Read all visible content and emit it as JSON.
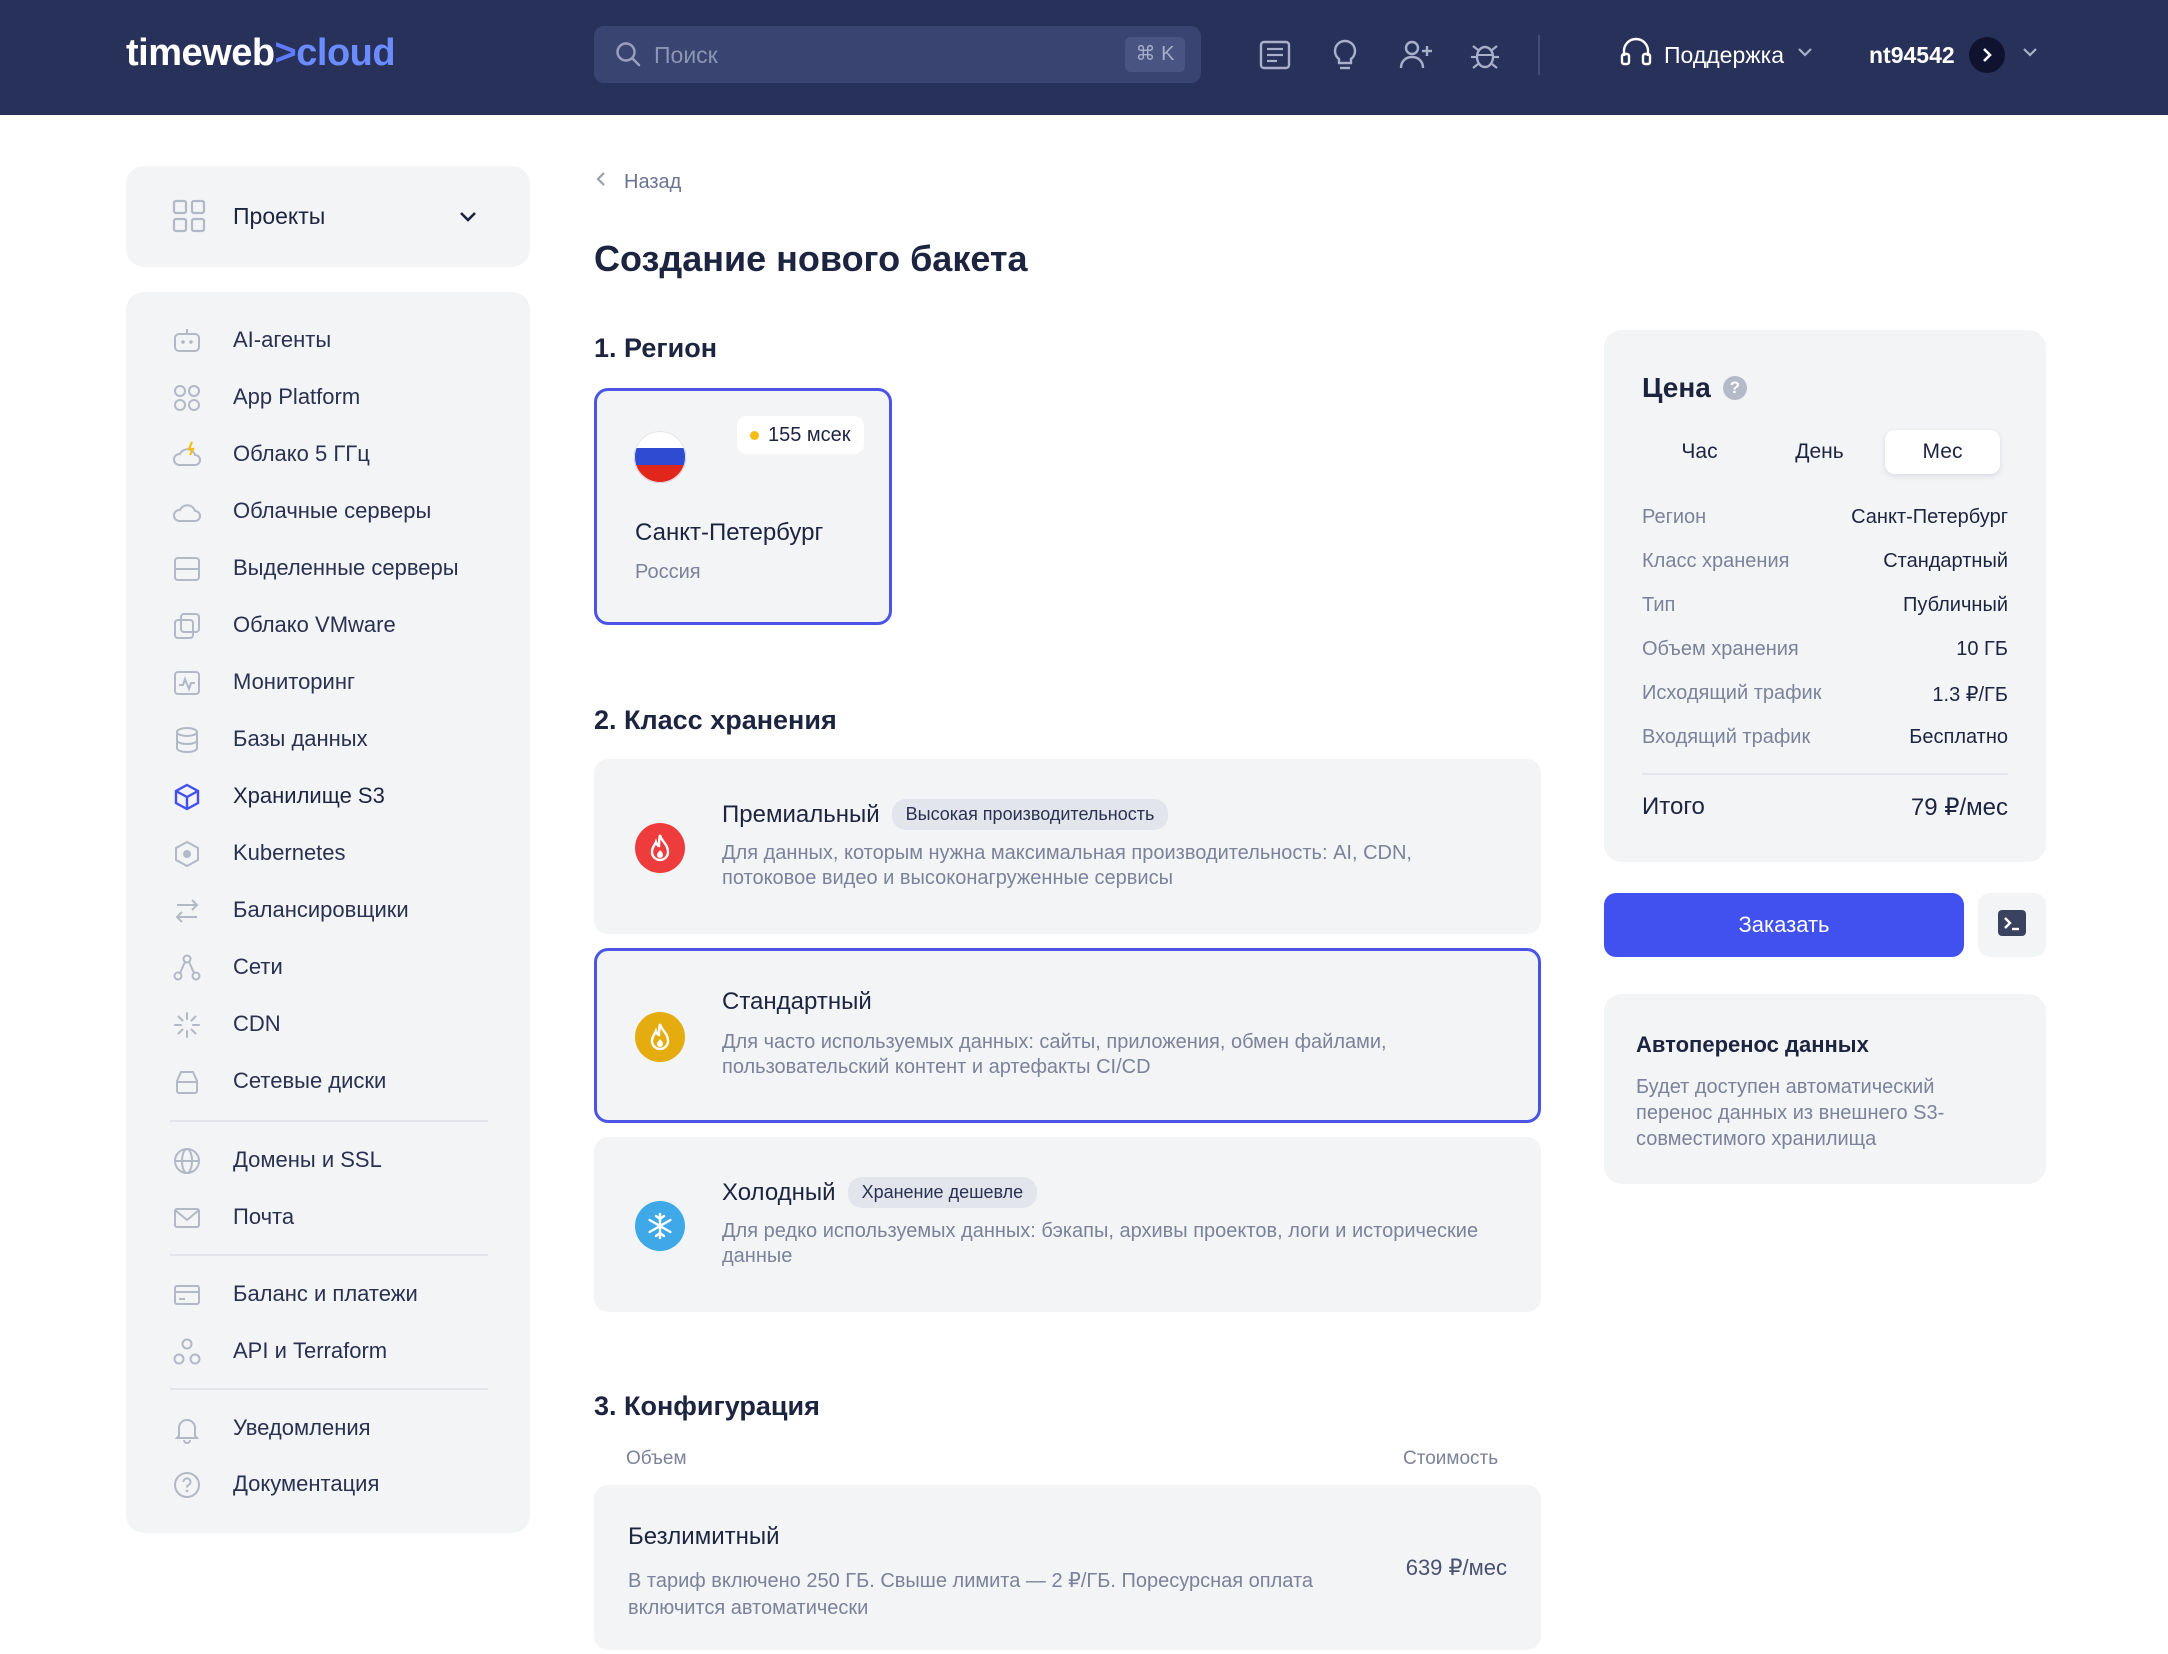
{
  "header": {
    "logo_left": "timeweb",
    "logo_sep": ">",
    "logo_right": "cloud",
    "search_placeholder": "Поиск",
    "search_shortcut": "⌘ K",
    "support_label": "Поддержка",
    "username": "nt94542"
  },
  "projects": {
    "label": "Проекты"
  },
  "sidebar": {
    "items": [
      {
        "label": "AI-агенты",
        "icon": "robot-icon"
      },
      {
        "label": "App Platform",
        "icon": "apps-icon"
      },
      {
        "label": "Облако 5 ГГц",
        "icon": "cloud-bolt-icon"
      },
      {
        "label": "Облачные серверы",
        "icon": "cloud-icon"
      },
      {
        "label": "Выделенные серверы",
        "icon": "server-icon"
      },
      {
        "label": "Облако VMware",
        "icon": "vmware-icon"
      },
      {
        "label": "Мониторинг",
        "icon": "monitoring-icon"
      },
      {
        "label": "Базы данных",
        "icon": "database-icon"
      },
      {
        "label": "Хранилище S3",
        "icon": "cube-icon"
      },
      {
        "label": "Kubernetes",
        "icon": "kubernetes-icon"
      },
      {
        "label": "Балансировщики",
        "icon": "balancer-icon"
      },
      {
        "label": "Сети",
        "icon": "network-icon"
      },
      {
        "label": "CDN",
        "icon": "cdn-icon"
      },
      {
        "label": "Сетевые диски",
        "icon": "disk-icon"
      },
      {
        "label": "Домены и SSL",
        "icon": "globe-icon"
      },
      {
        "label": "Почта",
        "icon": "mail-icon"
      },
      {
        "label": "Баланс и платежи",
        "icon": "card-icon"
      },
      {
        "label": "API и Terraform",
        "icon": "api-icon"
      },
      {
        "label": "Уведомления",
        "icon": "bell-icon"
      },
      {
        "label": "Документация",
        "icon": "help-icon"
      }
    ]
  },
  "main": {
    "back_label": "Назад",
    "title": "Создание нового бакета",
    "section_region": "1. Регион",
    "section_class": "2. Класс хранения",
    "section_config": "3. Конфигурация",
    "region": {
      "ping": "155 мсек",
      "city": "Санкт-Петербург",
      "country": "Россия"
    },
    "storage_classes": [
      {
        "name": "Премиальный",
        "badge": "Высокая производительность",
        "desc": "Для данных, которым нужна максимальная производительность: AI, CDN, потоковое видео и высоконагруженные сервисы",
        "color": "#ee3b3b"
      },
      {
        "name": "Стандартный",
        "badge": "",
        "desc": "Для часто используемых данных: сайты, приложения, обмен файлами, пользовательский контент и артефакты CI/CD",
        "color": "#e4ac0f"
      },
      {
        "name": "Холодный",
        "badge": "Хранение дешевле",
        "desc": "Для редко используемых данных: бэкапы, архивы проектов, логи и исторические данные",
        "color": "#3fa8e6"
      }
    ],
    "config": {
      "col_volume": "Объем",
      "col_cost": "Стоимость",
      "name": "Безлимитный",
      "desc": "В тариф включено 250 ГБ. Свыше лимита — 2 ₽/ГБ. Поресурсная оплата включится автоматически",
      "price": "639 ₽/мес"
    }
  },
  "price": {
    "title": "Цена",
    "help": "?",
    "periods": [
      "Час",
      "День",
      "Мес"
    ],
    "active_period": "Мес",
    "rows": [
      {
        "k": "Регион",
        "v": "Санкт-Петербург"
      },
      {
        "k": "Класс хранения",
        "v": "Стандартный"
      },
      {
        "k": "Тип",
        "v": "Публичный"
      },
      {
        "k": "Объем хранения",
        "v": "10 ГБ"
      },
      {
        "k": "Исходящий трафик",
        "v": "1.3 ₽/ГБ"
      },
      {
        "k": "Входящий трафик",
        "v": "Бесплатно"
      }
    ],
    "total_label": "Итого",
    "total_value": "79 ₽/мес",
    "order_label": "Заказать"
  },
  "autotransfer": {
    "title": "Автоперенос данных",
    "desc": "Будет доступен автоматический перенос данных из внешнего S3-совместимого хранилища"
  },
  "colors": {
    "accent": "#4151f0",
    "header_bg": "#27315a",
    "panel_bg": "#f3f4f6"
  }
}
